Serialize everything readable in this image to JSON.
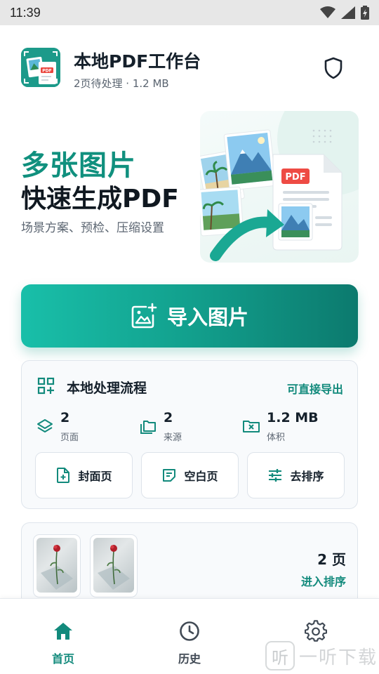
{
  "status_bar": {
    "time": "11:39"
  },
  "header": {
    "title": "本地PDF工作台",
    "subtitle": "2页待处理 · 1.2 MB",
    "logo_badge": "PDF"
  },
  "hero": {
    "heading_1": "多张图片",
    "heading_2": "快速生成PDF",
    "description": "场景方案、预检、压缩设置",
    "illustration_badge": "PDF"
  },
  "import_button": {
    "label": "导入图片"
  },
  "flow_card": {
    "title": "本地处理流程",
    "link": "可直接导出",
    "stats": [
      {
        "value": "2",
        "label": "页面",
        "icon": "layers-icon"
      },
      {
        "value": "2",
        "label": "来源",
        "icon": "folders-icon"
      },
      {
        "value": "1.2 MB",
        "label": "体积",
        "icon": "compress-folder-icon"
      }
    ],
    "actions": [
      {
        "label": "封面页",
        "icon": "add-file-icon"
      },
      {
        "label": "空白页",
        "icon": "blank-page-icon"
      },
      {
        "label": "去排序",
        "icon": "sliders-icon"
      }
    ]
  },
  "pages_card": {
    "count": "2 页",
    "link": "进入排序"
  },
  "bottom_nav": {
    "items": [
      {
        "label": "首页",
        "icon": "home-icon"
      },
      {
        "label": "历史",
        "icon": "clock-icon"
      },
      {
        "label": "",
        "icon": "gear-icon"
      }
    ]
  },
  "watermark": {
    "mark": "听",
    "text": "一听下载"
  },
  "colors": {
    "accent": "#12a08d",
    "accent_dark": "#0c7a6e",
    "text": "#15202b",
    "muted": "#5c6672"
  }
}
